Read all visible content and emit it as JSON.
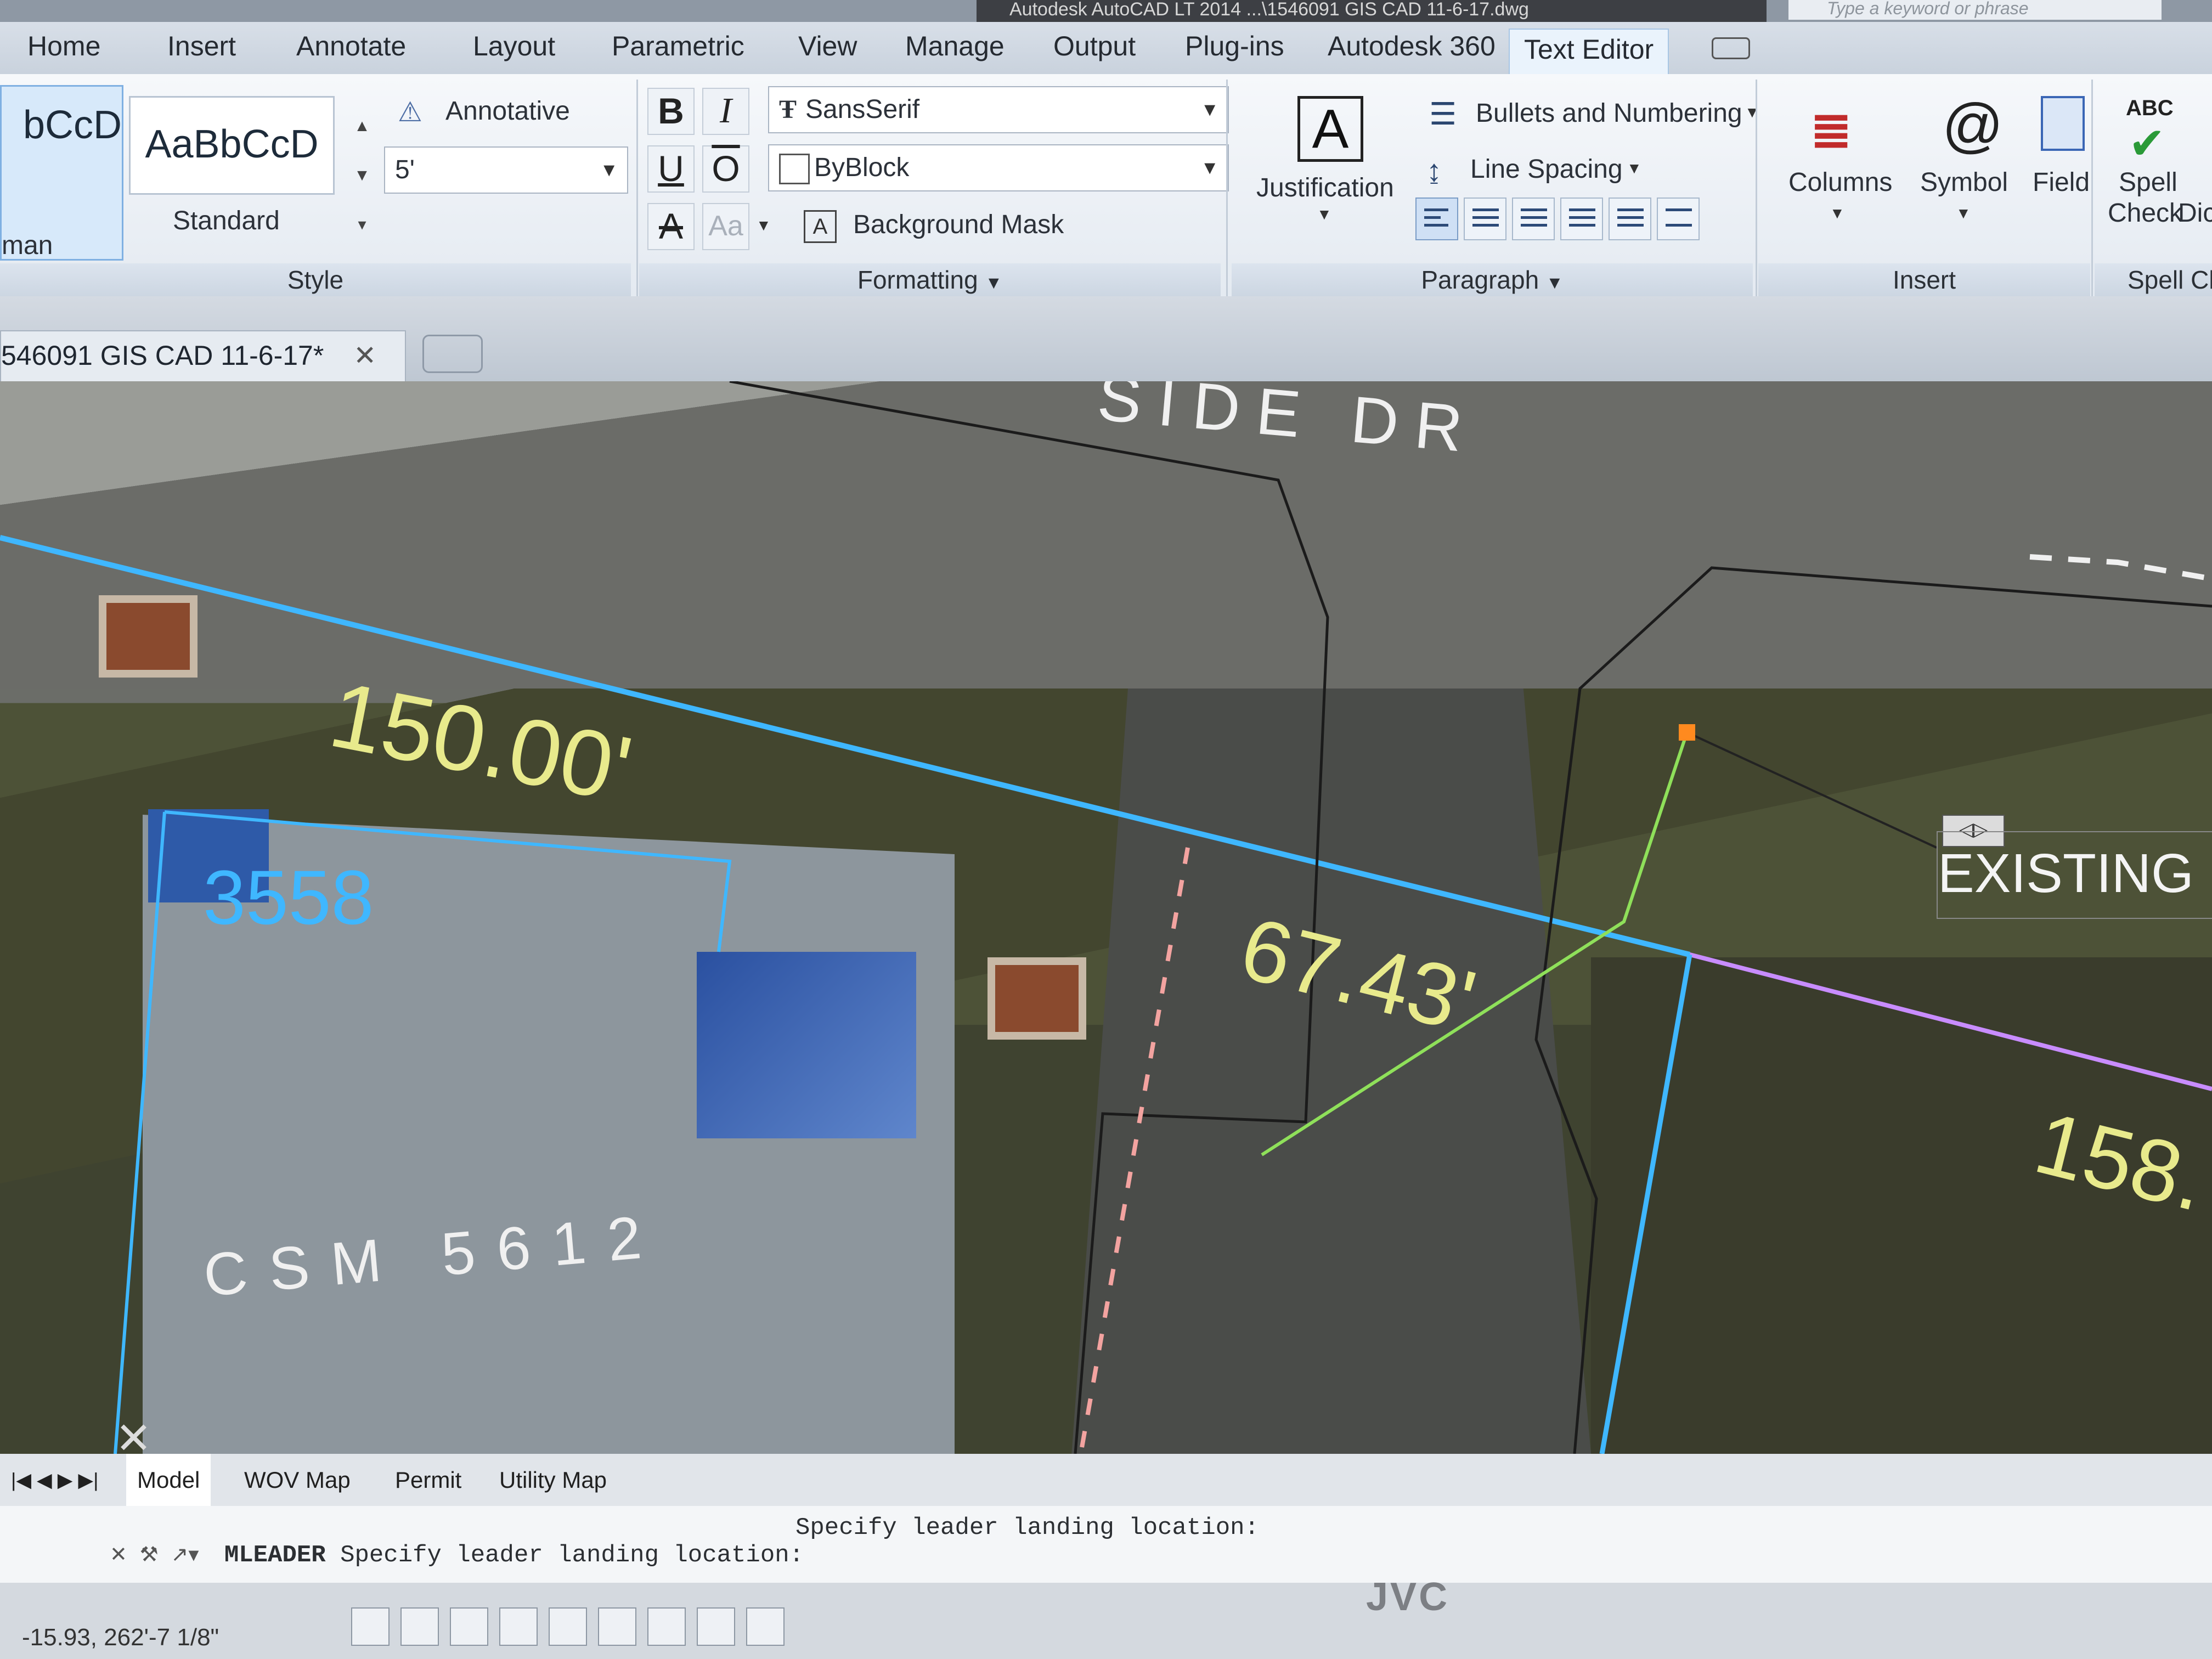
{
  "window": {
    "app_title": "Autodesk AutoCAD LT 2014  ...\\1546091 GIS CAD 11-6-17.dwg",
    "search_placeholder": "Type a keyword or phrase"
  },
  "ribbon_tabs": [
    "Home",
    "Insert",
    "Annotate",
    "Layout",
    "Parametric",
    "View",
    "Manage",
    "Output",
    "Plug-ins",
    "Autodesk 360",
    "Text Editor"
  ],
  "active_tab": "Text Editor",
  "style_panel": {
    "preview_left": "bCcD",
    "preview_left_name": "man",
    "preview_right": "AaBbCcD",
    "preview_right_name": "Standard",
    "annotative_label": "Annotative",
    "text_height": "5'",
    "title": "Style"
  },
  "formatting_panel": {
    "bold": "B",
    "italic": "I",
    "underline": "U",
    "overline": "O",
    "strike": "A",
    "case": "Aa",
    "font": "SansSerif",
    "color": "ByBlock",
    "background_mask": "Background Mask",
    "title": "Formatting"
  },
  "paragraph_panel": {
    "justification": "Justification",
    "bullets": "Bullets and Numbering",
    "line_spacing": "Line Spacing",
    "title": "Paragraph"
  },
  "insert_panel": {
    "columns": "Columns",
    "symbol": "Symbol",
    "field": "Field",
    "title": "Insert"
  },
  "spell_panel": {
    "spell_check_line1": "Spell",
    "spell_check_line2": "Check",
    "dict": "Dic",
    "title": "Spell Ch",
    "abc": "ABC"
  },
  "document_tab": "546091 GIS CAD 11-6-17*",
  "drawing": {
    "street": "SIDE DR",
    "dim_150": "150.00'",
    "dim_6743": "67.43'",
    "dim_158": "158.",
    "lot_number": "3558",
    "csm": "CSM  5612",
    "existing": "EXISTING P"
  },
  "layout_tabs": [
    "Model",
    "WOV Map",
    "Permit",
    "Utility Map"
  ],
  "active_layout": "Model",
  "command": {
    "prompt_line": "Specify leader landing location:",
    "command_name": "MLEADER",
    "command_text": "Specify leader landing location:"
  },
  "status": {
    "coords": "-15.93,  262'-7 1/8\""
  },
  "monitor_brand": "JVC",
  "colors": {
    "cad_dim_text": "#e8ea8c",
    "lot_line": "#3fb7ff",
    "leader": "#8fe05a"
  }
}
